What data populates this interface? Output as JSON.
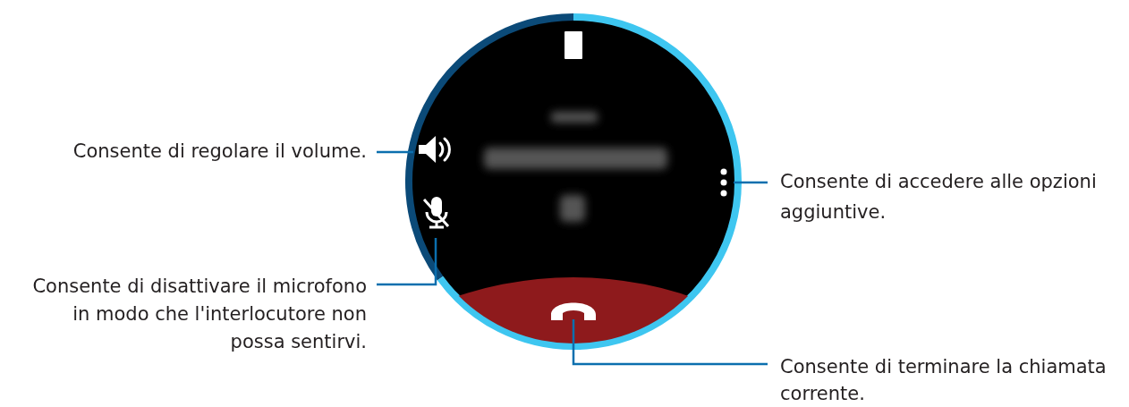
{
  "callouts": {
    "volume": "Consente di regolare il volume.",
    "mute": "Consente di disattivare il microfono\nin modo che l'interlocutore non\npossa sentirvi.",
    "options": "Consente di accedere alle opzioni\naggiuntive.",
    "end_call": "Consente di terminare la chiamata\ncorrente."
  }
}
